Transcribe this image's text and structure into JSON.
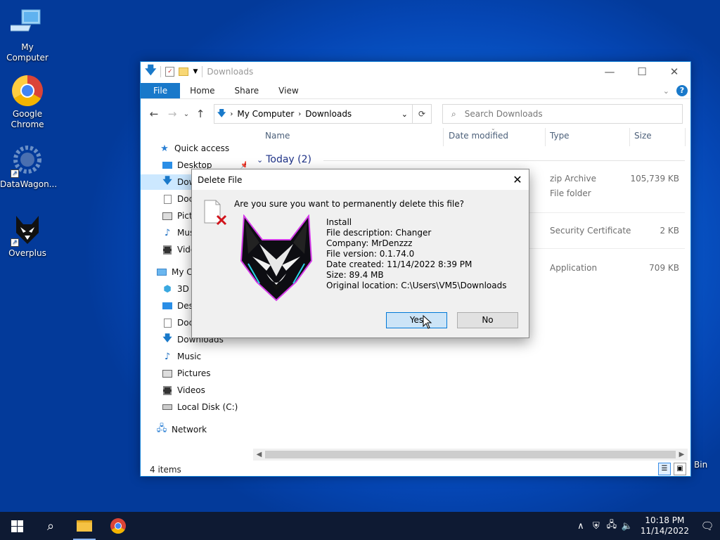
{
  "desktop": {
    "icons": [
      {
        "label": "My Computer"
      },
      {
        "label": "Google Chrome"
      },
      {
        "label": "DataWagon..."
      },
      {
        "label": "Overplus"
      }
    ],
    "recycle_bin_label": "Bin"
  },
  "explorer": {
    "title": "Downloads",
    "ribbon": {
      "file": "File",
      "home": "Home",
      "share": "Share",
      "view": "View",
      "help": "?"
    },
    "address": {
      "root": "My Computer",
      "current": "Downloads"
    },
    "search_placeholder": "Search Downloads",
    "nav": {
      "quick_access": "Quick access",
      "quick_items": [
        "Desktop",
        "Downloads",
        "Documents",
        "Pictures",
        "Music",
        "Videos"
      ],
      "this_pc": "My Computer",
      "pc_items": [
        "3D Objects",
        "Desktop",
        "Documents",
        "Downloads",
        "Music",
        "Pictures",
        "Videos",
        "Local Disk (C:)"
      ],
      "network": "Network"
    },
    "columns": {
      "name": "Name",
      "date": "Date modified",
      "type": "Type",
      "size": "Size"
    },
    "group": "Today (2)",
    "rows": [
      {
        "type": "zip Archive",
        "size": "105,739 KB"
      },
      {
        "type": "File folder",
        "size": ""
      },
      {
        "type": "Security Certificate",
        "size": "2 KB"
      },
      {
        "type": "Application",
        "size": "709 KB"
      }
    ],
    "status": "4 items"
  },
  "dialog": {
    "title": "Delete File",
    "question": "Are you sure you want to permanently delete this file?",
    "info": [
      "Install",
      "File description: Changer",
      "Company: MrDenzzz",
      "File version: 0.1.74.0",
      "Date created: 11/14/2022 8:39 PM",
      "Size: 89.4 MB",
      "Original location: C:\\Users\\VM5\\Downloads"
    ],
    "yes": "Yes",
    "no": "No"
  },
  "taskbar": {
    "time": "10:18 PM",
    "date": "11/14/2022"
  },
  "colors": {
    "accent": "#1979ca",
    "taskbar": "#0e1a33",
    "desktop": "#0b63d8"
  }
}
